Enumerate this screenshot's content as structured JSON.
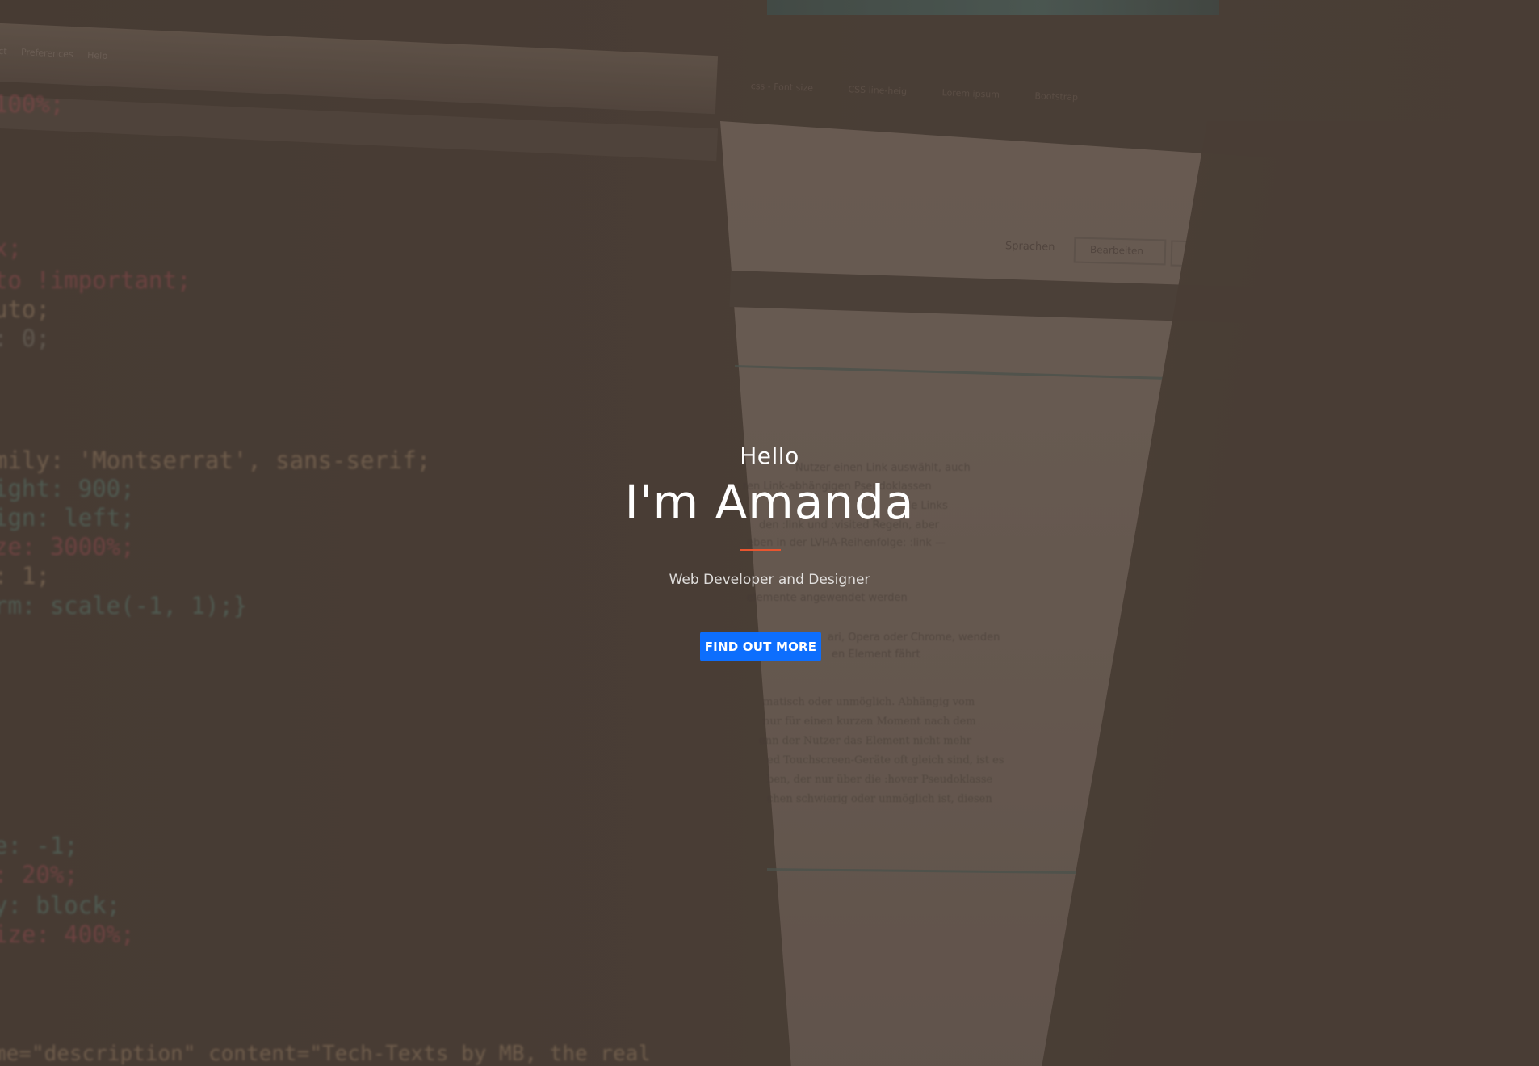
{
  "hero": {
    "greeting": "Hello",
    "name": "I'm Amanda",
    "subtitle": "Web Developer and Designer",
    "cta_label": "FIND OUT MORE"
  },
  "colors": {
    "accent_divider": "#e8552f",
    "cta_background": "#0d6efd",
    "overlay_tint": "#4a3e36"
  },
  "background": {
    "description_icon": "code-editor-photo",
    "code_lines": [
      "100%;",
      "x;",
      "to !important;",
      "uto;",
      ": 0;",
      "mily: 'Montserrat', sans-serif;",
      "ight: 900;",
      "ign: left;",
      "ze: 3000%;",
      ": 1;",
      "rm: scale(-1, 1);}",
      "e: -1;",
      ": 20%;",
      "y: block;",
      "ize: 400%;",
      "me=\"description\" content=\"Tech-Texts by MB, the real"
    ],
    "editor_menu": [
      "ject",
      "Preferences",
      "Help"
    ],
    "browser_tabs": [
      "css - Font size",
      "CSS line-heig",
      "Lorem ipsum",
      "Bootstrap"
    ],
    "screen_buttons": [
      "Sprachen",
      "Bearbeiten"
    ],
    "screen_text": [
      "Nutzer einen Link auswählt, auch",
      "ren Link-abhängigen Pseudoklassen",
      "de Links",
      "den :link und :visited Regeln, aber",
      "eben in der LVHA-Reihenfolge: :link —",
      "elemente angewendet werden",
      "ari, Opera oder Chrome, wenden",
      "en Element fährt",
      "matisch oder unmöglich. Abhängig vom",
      "nur für einen kurzen Moment nach dem",
      "enn der Nutzer das Element nicht mehr",
      "ed Touchscreen-Geräte oft gleich sind, ist es",
      "ben, der nur über die :hover Pseudoklasse",
      "chen schwierig oder unmöglich ist, diesen"
    ]
  }
}
